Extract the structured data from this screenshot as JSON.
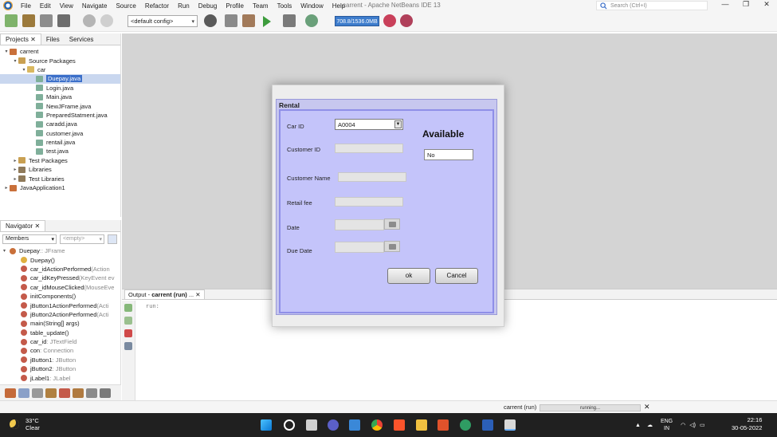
{
  "window": {
    "title": "carrent - Apache NetBeans IDE 13",
    "menu": [
      "File",
      "Edit",
      "View",
      "Navigate",
      "Source",
      "Refactor",
      "Run",
      "Debug",
      "Profile",
      "Team",
      "Tools",
      "Window",
      "Help"
    ],
    "search_placeholder": "Search (Ctrl+I)",
    "controls": [
      "—",
      "❐",
      "✕"
    ]
  },
  "toolbar": {
    "config": "<default config>",
    "memory": "708.8/1536.0MB"
  },
  "projects_panel": {
    "tabs": [
      "Projects",
      "Files",
      "Services"
    ],
    "tree": [
      {
        "label": "carrent",
        "depth": 0,
        "twisty": "▾",
        "icon": "project-icon"
      },
      {
        "label": "Source Packages",
        "depth": 1,
        "twisty": "▾",
        "icon": "folder-icon"
      },
      {
        "label": "car",
        "depth": 2,
        "twisty": "▾",
        "icon": "package-icon"
      },
      {
        "label": "Duepay.java",
        "depth": 3,
        "twisty": "",
        "icon": "java-form-icon",
        "selected": true
      },
      {
        "label": "Login.java",
        "depth": 3,
        "twisty": "",
        "icon": "java-form-icon"
      },
      {
        "label": "Main.java",
        "depth": 3,
        "twisty": "",
        "icon": "java-form-icon"
      },
      {
        "label": "NewJFrame.java",
        "depth": 3,
        "twisty": "",
        "icon": "java-form-icon"
      },
      {
        "label": "PreparedStatment.java",
        "depth": 3,
        "twisty": "",
        "icon": "java-form-icon"
      },
      {
        "label": "caradd.java",
        "depth": 3,
        "twisty": "",
        "icon": "java-form-icon"
      },
      {
        "label": "customer.java",
        "depth": 3,
        "twisty": "",
        "icon": "java-form-icon"
      },
      {
        "label": "rentail.java",
        "depth": 3,
        "twisty": "",
        "icon": "java-form-icon"
      },
      {
        "label": "test.java",
        "depth": 3,
        "twisty": "",
        "icon": "java-form-icon"
      },
      {
        "label": "Test Packages",
        "depth": 1,
        "twisty": "▸",
        "icon": "folder-icon"
      },
      {
        "label": "Libraries",
        "depth": 1,
        "twisty": "▸",
        "icon": "library-icon"
      },
      {
        "label": "Test Libraries",
        "depth": 1,
        "twisty": "▸",
        "icon": "library-icon"
      },
      {
        "label": "JavaApplication1",
        "depth": 0,
        "twisty": "▸",
        "icon": "project-icon"
      }
    ]
  },
  "navigator": {
    "title": "Navigator",
    "members_select": "Members",
    "empty_select": "<empty>",
    "items": [
      {
        "name": "Duepay",
        "type": " :: JFrame",
        "depth": 0
      },
      {
        "name": "Duepay()",
        "type": "",
        "depth": 1
      },
      {
        "name": "car_idActionPerformed",
        "type": "(Action",
        "depth": 1
      },
      {
        "name": "car_idKeyPressed",
        "type": "(KeyEvent ev",
        "depth": 1
      },
      {
        "name": "car_idMouseClicked",
        "type": "(MouseEve",
        "depth": 1
      },
      {
        "name": "initComponents()",
        "type": "",
        "depth": 1
      },
      {
        "name": "jButton1ActionPerformed",
        "type": "(Acti",
        "depth": 1
      },
      {
        "name": "jButton2ActionPerformed",
        "type": "(Acti",
        "depth": 1
      },
      {
        "name": "main(String[] args)",
        "type": "",
        "depth": 1
      },
      {
        "name": "table_update()",
        "type": "",
        "depth": 1
      },
      {
        "name": "car_id",
        "type": " : JTextField",
        "depth": 1
      },
      {
        "name": "con",
        "type": " : Connection",
        "depth": 1
      },
      {
        "name": "jButton1",
        "type": " : JButton",
        "depth": 1
      },
      {
        "name": "jButton2",
        "type": " : JButton",
        "depth": 1
      },
      {
        "name": "jLabel1",
        "type": " : JLabel",
        "depth": 1
      }
    ]
  },
  "output": {
    "tab_prefix": "Output - ",
    "tab_name": "carrent (run)",
    "tab_suffix": " ...",
    "text": "run:"
  },
  "status": {
    "task": "carrent (run)",
    "progress_label": "running...",
    "close": "✕"
  },
  "dialog": {
    "title": "Rental",
    "car_id_label": "Car ID",
    "car_id_value": "A0004",
    "customer_id_label": "Customer ID",
    "customer_name_label": "Customer Name",
    "retail_fee_label": "Retail fee",
    "date_label": "Date",
    "due_date_label": "Due Date",
    "available_label": "Available",
    "available_value": "No",
    "ok_label": "ok",
    "cancel_label": "Cancel"
  },
  "taskbar": {
    "temperature": "33°C",
    "condition": "Clear",
    "lang1": "ENG",
    "lang2": "IN",
    "time": "22:16",
    "date": "30-05-2022"
  },
  "colors": {
    "dialog_panel": "#c4c4fa",
    "selection": "#3b6fc9",
    "taskbar": "#202020"
  }
}
